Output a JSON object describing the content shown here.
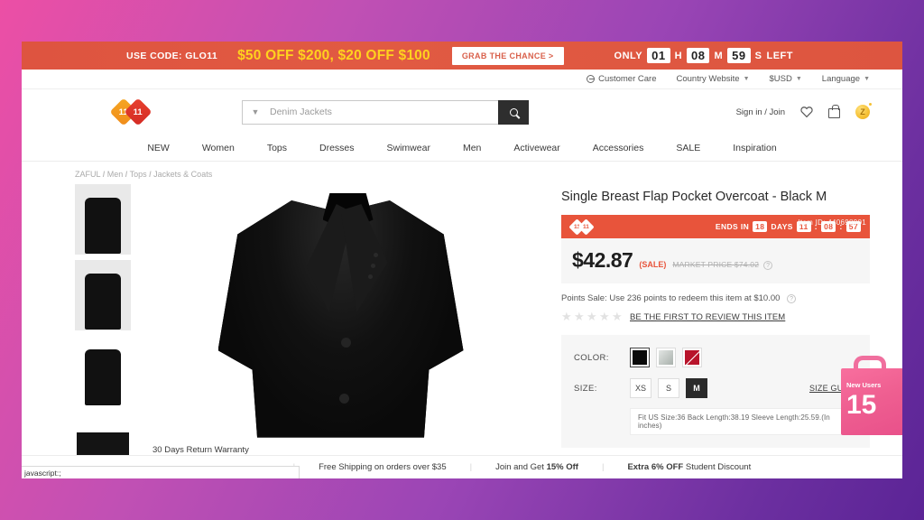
{
  "promo_bar": {
    "code_label": "USE CODE: GLO11",
    "offer": "$50 OFF $200, $20 OFF $100",
    "cta": "GRAB THE CHANCE >",
    "only_label": "ONLY",
    "hours": "01",
    "hours_unit": "H",
    "minutes": "08",
    "minutes_unit": "M",
    "seconds": "59",
    "seconds_unit": "S",
    "left_label": "LEFT",
    "bg_color": "#e0563f",
    "offer_color": "#ffd21e"
  },
  "utility_bar": {
    "customer_care": "Customer Care",
    "country_website": "Country Website",
    "currency": "$USD",
    "language": "Language"
  },
  "header": {
    "logo_left": "11",
    "logo_right": "11",
    "search_placeholder": "Denim Jackets",
    "search_value": "",
    "sign_in": "Sign in / Join",
    "coin_label": "Z"
  },
  "nav": {
    "items": [
      {
        "label": "NEW"
      },
      {
        "label": "Women"
      },
      {
        "label": "Tops"
      },
      {
        "label": "Dresses"
      },
      {
        "label": "Swimwear"
      },
      {
        "label": "Men"
      },
      {
        "label": "Activewear"
      },
      {
        "label": "Accessories"
      },
      {
        "label": "SALE"
      },
      {
        "label": "Inspiration"
      }
    ]
  },
  "breadcrumb": {
    "items": [
      "ZAFUL",
      "Men",
      "Tops",
      "Jackets & Coats"
    ],
    "separator": "/"
  },
  "product": {
    "title": "Single Breast Flap Pocket Overcoat - Black M",
    "deal": {
      "logo_left": "11",
      "logo_right": "11",
      "ends_in_label": "ENDS IN",
      "days": "18",
      "days_label": "DAYS",
      "hours": "11",
      "minutes": "08",
      "seconds": "57",
      "colon": ":"
    },
    "price": "$42.87",
    "sale_tag": "(SALE)",
    "market_price": "MARKET PRICE $74.02",
    "help_icon": "?",
    "points_sale": "Points Sale: Use 236 points to redeem this item at $10.00",
    "review_link": "BE THE FIRST TO REVIEW THIS ITEM",
    "star_glyph": "★",
    "star_count": 5,
    "color_label": "COLOR:",
    "colors": [
      {
        "name": "black",
        "hex": "#0a0a0a",
        "selected": true,
        "soldout": false
      },
      {
        "name": "gray",
        "hex": "#c2c8c4",
        "selected": false,
        "soldout": false
      },
      {
        "name": "red",
        "hex": "#b8142b",
        "selected": false,
        "soldout": true
      }
    ],
    "size_label": "SIZE:",
    "sizes": [
      {
        "label": "XS",
        "selected": false
      },
      {
        "label": "S",
        "selected": false
      },
      {
        "label": "M",
        "selected": true
      }
    ],
    "size_guide": "SIZE GUIDE",
    "fit_note": "Fit US Size:36  Back Length:38.19  Sleeve Length:25.59.(In inches)"
  },
  "bottom_strip": {
    "warranty": "30 Days Return Warranty",
    "shipping": "Free Shipping on orders over $35",
    "join": "Join and Get ",
    "join_bold": "15% Off",
    "student_bold": "Extra 6% OFF",
    "student": " Student Discount",
    "separator": "|"
  },
  "status_bar": {
    "text": "javascript:;"
  },
  "promo_widget": {
    "text": "New Users",
    "number": "15"
  },
  "ghost_hint": {
    "text": "Item ID: 440698901"
  }
}
